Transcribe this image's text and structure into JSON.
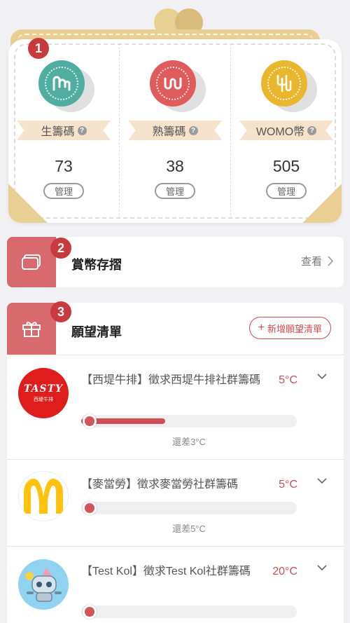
{
  "wallet": {
    "badge": "1",
    "coins": [
      {
        "name": "生籌碼",
        "amount": "73",
        "manage_label": "管理",
        "color": "#4fae9f",
        "icon": "m-wave-icon"
      },
      {
        "name": "熟籌碼",
        "amount": "38",
        "manage_label": "管理",
        "color": "#e05b5b",
        "icon": "w-wave-icon"
      },
      {
        "name": "WOMO幣",
        "amount": "505",
        "manage_label": "管理",
        "color": "#e8b72d",
        "icon": "womo-icon"
      }
    ],
    "help_glyph": "?"
  },
  "deposit": {
    "badge": "2",
    "title": "賞幣存摺",
    "view_label": "查看"
  },
  "wishlist": {
    "badge": "3",
    "title": "願望清單",
    "add_label": "新增願望清單",
    "items": [
      {
        "title": "【西堤牛排】徵求西堤牛排社群籌碼",
        "temp": "5°C",
        "progress": 0.39,
        "gap": "還差3°C",
        "avatar_text": "TASTY",
        "avatar_sub": "西堤牛排"
      },
      {
        "title": "【麥當勞】徵求麥當勞社群籌碼",
        "temp": "5°C",
        "progress": 0,
        "gap": "還差5°C"
      },
      {
        "title": "【Test Kol】徵求Test Kol社群籌碼",
        "temp": "20°C",
        "progress": 0,
        "gap": ""
      }
    ]
  },
  "colors": {
    "accent": "#c93a3f",
    "section_icon_bg": "#d8696d",
    "wallet_gold": "#e9cf93"
  }
}
